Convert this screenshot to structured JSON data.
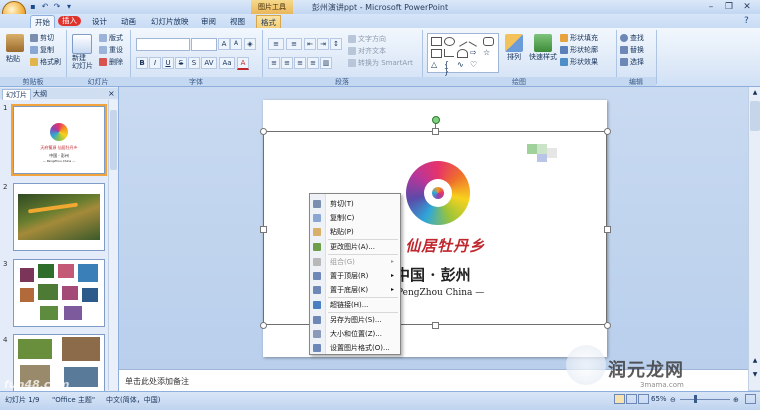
{
  "window": {
    "title": "彭州演讲ppt - Microsoft PowerPoint",
    "context_tool": "图片工具"
  },
  "tabs": [
    {
      "label": "开始"
    },
    {
      "label": "插入"
    },
    {
      "label": "设计"
    },
    {
      "label": "动画"
    },
    {
      "label": "幻灯片放映"
    },
    {
      "label": "审阅"
    },
    {
      "label": "视图"
    },
    {
      "label": "格式"
    }
  ],
  "ribbon": {
    "clipboard": {
      "paste": "粘贴",
      "cut": "剪切",
      "copy": "复制",
      "format_painter": "格式刷",
      "group": "剪贴板"
    },
    "slides": {
      "new_slide": "新建\n幻灯片",
      "layout": "版式",
      "reset": "重设",
      "delete": "删除",
      "group": "幻灯片"
    },
    "font": {
      "group": "字体",
      "font_size_up": "A",
      "font_size_down": "A",
      "bold": "B",
      "italic": "I",
      "underline": "U",
      "strike": "S",
      "shadow": "S",
      "spacing": "AV",
      "case": "Aa",
      "color": "A"
    },
    "paragraph": {
      "group": "段落",
      "text_direction": "文字方向",
      "align_text": "对齐文本",
      "smartart": "转换为 SmartArt"
    },
    "drawing": {
      "group": "绘图",
      "arrange": "排列",
      "quick_styles": "快速样式",
      "shape_fill": "形状填充",
      "shape_outline": "形状轮廓",
      "shape_effects": "形状效果"
    },
    "editing": {
      "group": "编辑",
      "find": "查找",
      "replace": "替换",
      "select": "选择"
    }
  },
  "panel": {
    "tab_slides": "幻灯片",
    "tab_outline": "大纲",
    "thumbs": [
      {
        "num": "1"
      },
      {
        "num": "2"
      },
      {
        "num": "3"
      },
      {
        "num": "4"
      }
    ]
  },
  "slide": {
    "slogan": "天府蜀源 仙居牡丹乡",
    "slogan_visible": "蜀源  仙居牡丹乡",
    "heading_visible": "中国 · 彭州",
    "subtitle_visible": "PengZhou China —",
    "thumb1_slogan": "天府蜀源 仙居牡丹乡",
    "thumb1_title": "中国 · 彭州",
    "thumb1_sub": "— PengZhou China —"
  },
  "context_menu": {
    "items": [
      {
        "label": "剪切(T)",
        "icon": "scissors-icon",
        "disabled": false
      },
      {
        "label": "复制(C)",
        "icon": "copy-icon",
        "disabled": false
      },
      {
        "label": "粘贴(P)",
        "icon": "paste-icon",
        "disabled": false
      },
      {
        "label": "更改图片(A)...",
        "icon": "change-picture-icon",
        "disabled": false
      },
      {
        "label": "组合(G)",
        "icon": "group-icon",
        "disabled": true,
        "submenu": true
      },
      {
        "label": "置于顶层(R)",
        "icon": "bring-front-icon",
        "disabled": false,
        "submenu": true
      },
      {
        "label": "置于底层(K)",
        "icon": "send-back-icon",
        "disabled": false,
        "submenu": true
      },
      {
        "label": "超链接(H)...",
        "icon": "hyperlink-icon",
        "disabled": false
      },
      {
        "label": "另存为图片(S)...",
        "icon": "save-picture-icon",
        "disabled": false
      },
      {
        "label": "大小和位置(Z)...",
        "icon": "size-position-icon",
        "disabled": false
      },
      {
        "label": "设置图片格式(O)...",
        "icon": "format-picture-icon",
        "disabled": false
      }
    ]
  },
  "notes": {
    "placeholder": "单击此处添加备注"
  },
  "status": {
    "slide_info": "幻灯片 1/9",
    "theme": "\"Office 主题\"",
    "language": "中文(简体，中国)",
    "zoom": "65%"
  },
  "watermarks": {
    "left": "fun48.com",
    "right": "润元龙网",
    "right_url": "3mama.com"
  },
  "colors": {
    "accent_red": "#c0262d",
    "ribbon_blue": "#dce8f7",
    "format_tab": "#f1cd77",
    "selection_orange": "#f3a33b"
  }
}
